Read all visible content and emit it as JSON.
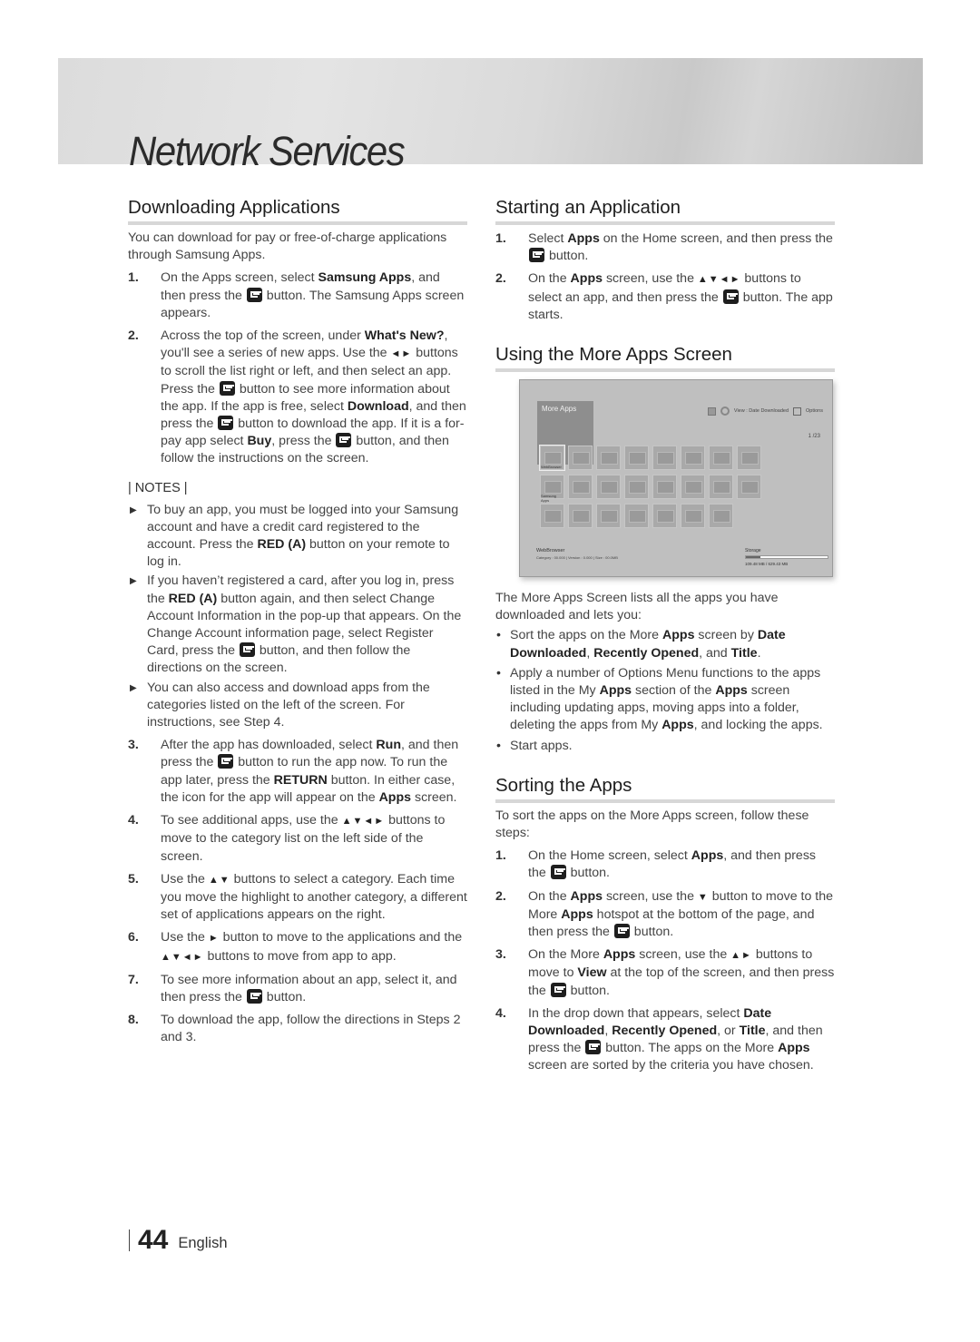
{
  "header": {
    "title": "Network Services"
  },
  "left": {
    "heading": "Downloading Applications",
    "intro": "You can download for pay or free-of-charge applications through Samsung Apps.",
    "steps": [
      {
        "num": "1.",
        "parts": [
          "On the Apps screen, select ",
          "Samsung Apps",
          ", and then press the ",
          "[enter]",
          " button. The Samsung Apps screen appears."
        ]
      },
      {
        "num": "2.",
        "parts": [
          "Across the top of the screen, under ",
          "What's New?",
          ", you'll see a series of new apps. Use the ",
          "◄►",
          " buttons to scroll the list right or left, and then select an app. Press the ",
          "[enter]",
          " button to see more information about the app. If the app is free, select ",
          "Download",
          ", and then press the ",
          "[enter]",
          " button to download the app. If it is a for-pay app select ",
          "Buy",
          ", press the ",
          "[enter]",
          " button, and then follow the instructions on the screen."
        ]
      }
    ],
    "notes_label": "| NOTES |",
    "notes": [
      "To buy an app, you must be logged into your Samsung account and have a credit card registered to the account. Press the RED (A) button on your remote to log in.",
      "If you haven’t registered a card, after you log in, press the RED (A) button again, and then select Change Account Information in the pop-up that appears. On the Change Account information page, select Register Card, press the [enter] button, and then follow the directions on the screen.",
      "You can also access and download apps from the categories listed on the left of the screen. For instructions, see Step 4."
    ],
    "steps2": [
      {
        "num": "3.",
        "text": "After the app has downloaded, select Run, and then press the [enter] button to run the app now. To run the app later, press the RETURN button. In either case, the icon for the app will appear on the Apps screen."
      },
      {
        "num": "4.",
        "text": "To see additional apps, use the ▲▼◄► buttons to move to the category list on the left side of the screen."
      },
      {
        "num": "5.",
        "text": "Use the ▲▼ buttons to select a category. Each time you move the highlight to another category, a different set of applications appears on the right."
      },
      {
        "num": "6.",
        "text": "Use the ► button to move to the applications and the ▲▼◄► buttons to move from app to app."
      },
      {
        "num": "7.",
        "text": "To see more information about an app, select it, and then press the [enter] button."
      },
      {
        "num": "8.",
        "text": "To download the app, follow the directions in Steps 2 and 3."
      }
    ]
  },
  "right": {
    "starting": {
      "heading": "Starting an Application",
      "steps": [
        {
          "num": "1.",
          "text": "Select Apps on the Home screen, and then press the [enter] button."
        },
        {
          "num": "2.",
          "text": "On the Apps screen, use the ▲▼◄► buttons to select an app, and then press the [enter] button. The app starts."
        }
      ]
    },
    "more_apps": {
      "heading": "Using the More Apps Screen",
      "screen": {
        "title": "More Apps",
        "view": "View : Date Downloaded",
        "options": "Options",
        "page": "1 /23",
        "tile1_label": "WebBrowser",
        "tile2_label": "Samsung Apps",
        "info_name": "WebBrowser",
        "info_meta": "Category : 00.000 | Version : 0.000 | Size : 00.0MB",
        "storage_label": "Storage",
        "storage_value": "109.48 MB / 629.43 MB",
        "storage_fraction": 0.174,
        "rows": [
          8,
          8,
          7
        ]
      },
      "intro": "The More Apps Screen lists all the apps you have downloaded and lets you:",
      "bullets": [
        "Sort the apps on the More Apps screen by Date Downloaded, Recently Opened, and Title.",
        "Apply a number of Options Menu functions to the apps listed in the My Apps section of the Apps screen including updating apps, moving apps into a folder, deleting the apps from My Apps, and locking the apps.",
        "Start apps."
      ]
    },
    "sorting": {
      "heading": "Sorting the Apps",
      "intro": "To sort the apps on the More Apps screen, follow these steps:",
      "steps": [
        {
          "num": "1.",
          "text": "On the Home screen, select Apps, and then press the [enter] button."
        },
        {
          "num": "2.",
          "text": "On the Apps screen, use the ▼ button to move to the More Apps hotspot at the bottom of the page, and then press the [enter] button."
        },
        {
          "num": "3.",
          "text": "On the More Apps screen, use the ▲► buttons to move to View at the top of the screen, and then press the [enter] button."
        },
        {
          "num": "4.",
          "text": "In the drop down that appears, select Date Downloaded, Recently Opened, or Title, and then press the [enter] button. The apps on the More Apps screen are sorted by the criteria you have chosen."
        }
      ]
    }
  },
  "bold_terms": [
    "Samsung Apps",
    "What's New?",
    "Download",
    "Buy",
    "RED (A)",
    "Run",
    "RETURN",
    "Apps",
    "Date Downloaded",
    "Recently Opened",
    "Title",
    "Date",
    "Downloaded",
    "View"
  ],
  "footer": {
    "page_number": "44",
    "language": "English"
  }
}
